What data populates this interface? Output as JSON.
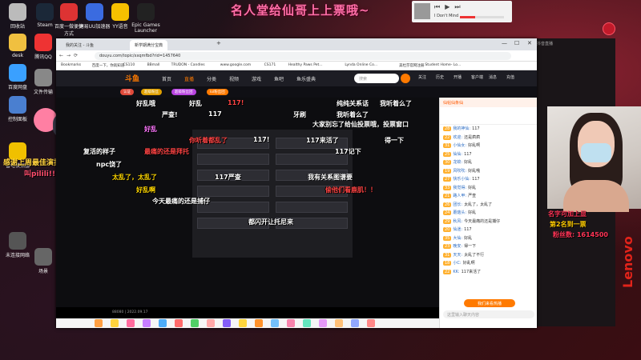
{
  "stream_title": "名人堂给仙哥上上票哦~",
  "music": {
    "song": "I Don't Mind",
    "progress": 0.35
  },
  "desktop_icons": [
    {
      "label": "回收站",
      "color": "#bbb"
    },
    {
      "label": "Steam",
      "color": "#1b2838"
    },
    {
      "label": "百度一做便捷方式",
      "color": "#d33"
    },
    {
      "label": "网易UU加速器",
      "color": "#3a6be0"
    },
    {
      "label": "YY语音",
      "color": "#f6c000"
    },
    {
      "label": "Epic Games Launcher",
      "color": "#222"
    },
    {
      "label": "desk",
      "color": "#f0c040"
    },
    {
      "label": "腾讯QQ",
      "color": "#e33"
    },
    {
      "label": "百度网盘",
      "color": "#3aa0ff"
    },
    {
      "label": "文件传输",
      "color": "#888"
    },
    {
      "label": "控制面板",
      "color": "#4a7fd0"
    },
    {
      "label": "雷电模拟器",
      "color": "#f0c000"
    },
    {
      "label": "未连接网络",
      "color": "#555"
    },
    {
      "label": "场景",
      "color": "#666"
    }
  ],
  "browser": {
    "tabs": [
      "我的关注 - 斗鱼",
      "新学期满分宝典"
    ],
    "url": "douyu.com/topic/xxqmfbd?rid=1457640",
    "bookmarks": [
      "Bookmarks",
      "百度一下，你就知道",
      "CS110",
      "BBmall",
      "TRUDON - Candles",
      "www.google.com",
      "CS171",
      "Healthy Paws Pet...",
      "Lynda Online Co...",
      "美杜莎官网注册",
      "Student Home- Lo..."
    ]
  },
  "douyu": {
    "logo": "斗鱼",
    "nav": [
      "首页",
      "直播",
      "分类",
      "视频",
      "游戏",
      "鱼吧",
      "鱼乐盛典"
    ],
    "search_placeholder": "搜索",
    "top_icons": [
      "关注",
      "历史",
      "开播",
      "客户端",
      "消息",
      "充值"
    ],
    "badges": [
      "认证",
      "超级粉丝",
      "超级粉丝团",
      "lol粉丝团"
    ]
  },
  "danmu": [
    {
      "text": "好乱哦",
      "color": "#ffffff"
    },
    {
      "text": "好乱",
      "color": "#ffffff"
    },
    {
      "text": "117!",
      "color": "#ff4444"
    },
    {
      "text": "纯纯关系话",
      "color": "#ffffff"
    },
    {
      "text": "我听着么了",
      "color": "#ffffff"
    },
    {
      "text": "严查!",
      "color": "#ffffff"
    },
    {
      "text": "117",
      "color": "#ffffff"
    },
    {
      "text": "牙刷",
      "color": "#ffffff"
    },
    {
      "text": "我听着么了",
      "color": "#ffffff"
    },
    {
      "text": "大家别忘了给仙投票哦，投票窗口",
      "color": "#ffffff"
    },
    {
      "text": "好乱",
      "color": "#ff77ff"
    },
    {
      "text": "你听着都乱了",
      "color": "#ff4444"
    },
    {
      "text": "117!",
      "color": "#ffffff"
    },
    {
      "text": "117来活了",
      "color": "#ffffff"
    },
    {
      "text": "得一下",
      "color": "#ffffff"
    },
    {
      "text": "复活的样子",
      "color": "#ffffff"
    },
    {
      "text": "最痛的还是拜托",
      "color": "#ff4444"
    },
    {
      "text": "117记下",
      "color": "#ffffff"
    },
    {
      "text": "npc饶了",
      "color": "#ffffff"
    },
    {
      "text": "117严查",
      "color": "#ffffff"
    },
    {
      "text": "太乱了，太乱了",
      "color": "#ffd700"
    },
    {
      "text": "我有关系图谱要",
      "color": "#ffffff"
    },
    {
      "text": "好乱啊",
      "color": "#ffd700"
    },
    {
      "text": "今天最痛的还是捕仔",
      "color": "#ffffff"
    },
    {
      "text": "偷他们看鹿肌！！",
      "color": "#ff4444"
    },
    {
      "text": "都闪开让托尼来",
      "color": "#ffffff"
    }
  ],
  "player_footer": "88080 | 2022.09.17",
  "chat": {
    "header": "仙帖仙条仙",
    "lines": [
      {
        "lv": "28",
        "name": "我的神仙",
        "text": "117"
      },
      {
        "lv": "22",
        "name": "欢迎",
        "text": "还是疯疯"
      },
      {
        "lv": "31",
        "name": "小仙女",
        "text": "好乱啊"
      },
      {
        "lv": "25",
        "name": "仙仙",
        "text": "117"
      },
      {
        "lv": "30",
        "name": "龙蛟",
        "text": "好乱"
      },
      {
        "lv": "19",
        "name": "风吹吹",
        "text": "好乱哦"
      },
      {
        "lv": "27",
        "name": "快乐小仙",
        "text": "117"
      },
      {
        "lv": "33",
        "name": "我觉得",
        "text": "好乱"
      },
      {
        "lv": "21",
        "name": "路人甲",
        "text": "严查"
      },
      {
        "lv": "26",
        "name": "团长",
        "text": "太乱了，太乱了"
      },
      {
        "lv": "24",
        "name": "蘑菇头",
        "text": "好乱"
      },
      {
        "lv": "29",
        "name": "秋风",
        "text": "今天最痛的还是捕仔"
      },
      {
        "lv": "20",
        "name": "仙迷",
        "text": "117"
      },
      {
        "lv": "35",
        "name": "大仙",
        "text": "好乱"
      },
      {
        "lv": "23",
        "name": "晚安",
        "text": "得一下"
      },
      {
        "lv": "31",
        "name": "天天",
        "text": "太乱了不行"
      },
      {
        "lv": "18",
        "name": "小C",
        "text": "好乱啊"
      },
      {
        "lv": "22",
        "name": "KK",
        "text": "117来活了"
      }
    ],
    "send_label": "我们来看热播",
    "input_placeholder": "这里输入聊天内容"
  },
  "overlay": {
    "line1": "名字可加上显",
    "line2": "第2名到一票",
    "line3": "粉丝数: 1614500"
  },
  "left_overlay": {
    "line1": "感谢上周最佳演技员",
    "line2": "叫pilili!!"
  },
  "brand": "Lenovo",
  "stream_panel_title": "抖音直播"
}
